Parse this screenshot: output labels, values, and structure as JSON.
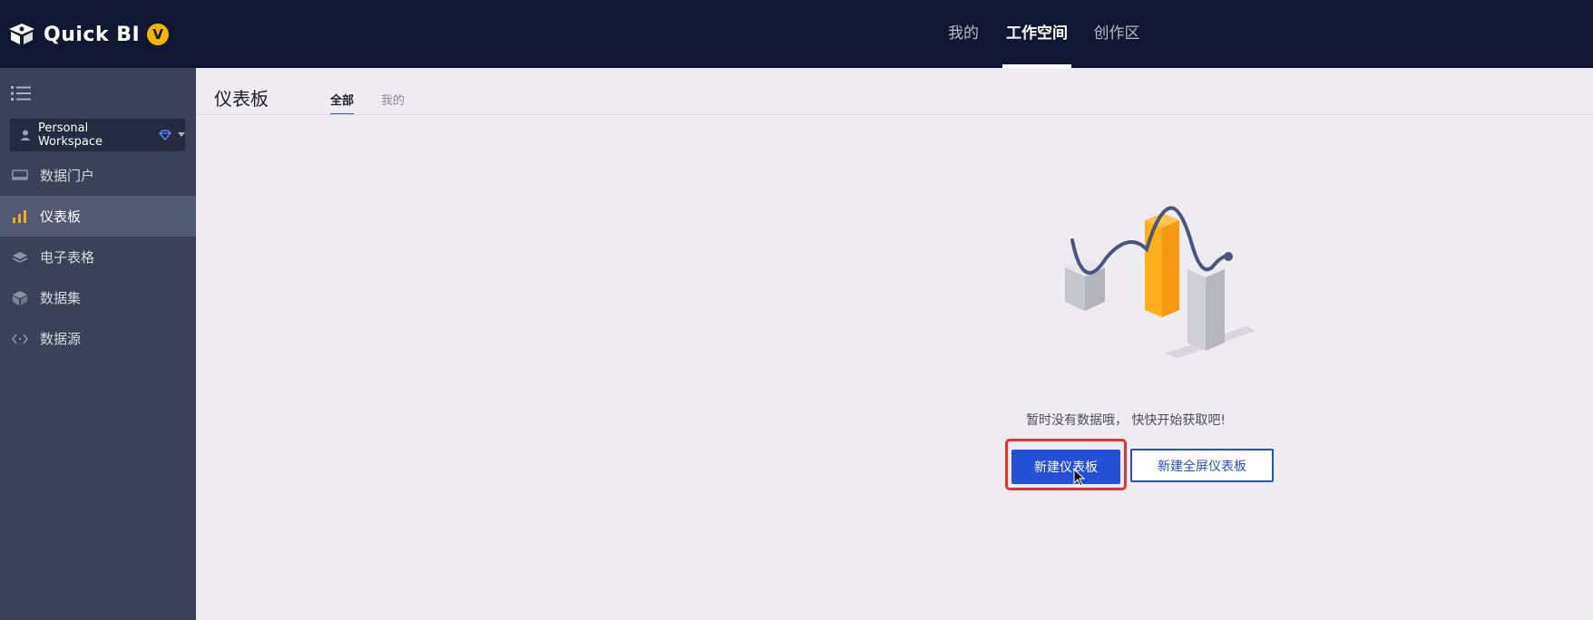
{
  "app": {
    "logo_text": "Quick BI",
    "logo_badge": "V"
  },
  "topnav": {
    "items": [
      {
        "label": "我的"
      },
      {
        "label": "工作空间",
        "active": true
      },
      {
        "label": "创作区"
      }
    ]
  },
  "sidebar": {
    "menu_icon": "list-menu-icon",
    "workspace": {
      "label": "Personal Workspace",
      "icon": "user-icon"
    },
    "items": [
      {
        "label": "数据门户",
        "icon": "portal-icon"
      },
      {
        "label": "仪表板",
        "icon": "bar-chart-icon",
        "active": true
      },
      {
        "label": "电子表格",
        "icon": "layers-icon"
      },
      {
        "label": "数据集",
        "icon": "cube-icon"
      },
      {
        "label": "数据源",
        "icon": "code-arrows-icon"
      }
    ]
  },
  "main": {
    "title": "仪表板",
    "tabs": [
      {
        "label": "全部",
        "active": true
      },
      {
        "label": "我的"
      }
    ],
    "empty_state": {
      "message": "暂时没有数据哦， 快快开始获取吧!",
      "primary_button": "新建仪表板",
      "secondary_button": "新建全屏仪表板"
    }
  },
  "colors": {
    "topbar": "#0f1733",
    "sidebar": "#3a4158",
    "sidebar_active": "#525a72",
    "accent": "#2450d6",
    "highlight": "#e03434",
    "badge": "#f5b400"
  }
}
